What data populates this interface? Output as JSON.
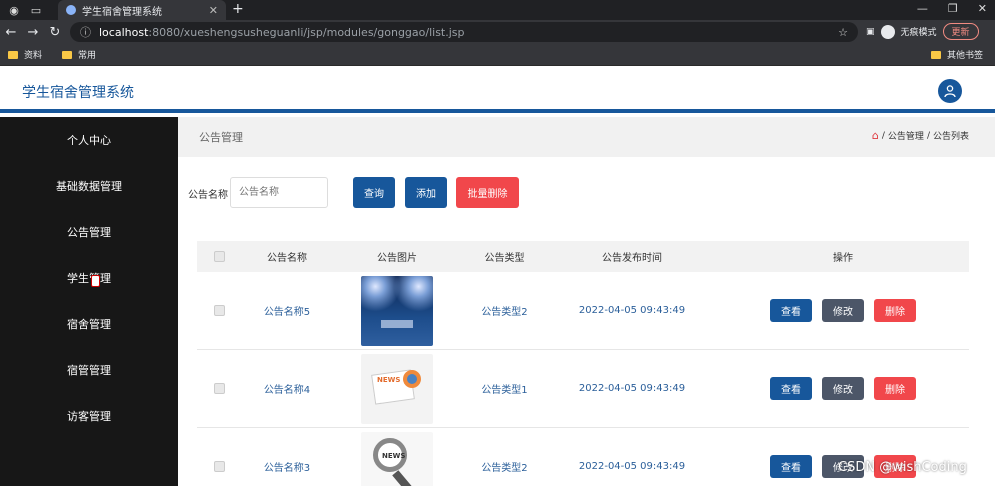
{
  "browser": {
    "tab_title": "学生宿舍管理系统",
    "url_host": "localhost",
    "url_rest": ":8080/xueshengsusheguanli/jsp/modules/gonggao/list.jsp",
    "incognito_label": "无痕模式",
    "update_label": "更新",
    "bookmarks": [
      "资料",
      "常用"
    ],
    "other_bookmarks": "其他书签"
  },
  "header": {
    "title": "学生宿舍管理系统"
  },
  "sidebar": {
    "items": [
      {
        "label": "个人中心"
      },
      {
        "label": "基础数据管理"
      },
      {
        "label": "公告管理"
      },
      {
        "label": "学生管理"
      },
      {
        "label": "宿舍管理"
      },
      {
        "label": "宿管管理"
      },
      {
        "label": "访客管理"
      }
    ]
  },
  "page": {
    "title": "公告管理",
    "breadcrumb": [
      "公告管理",
      "公告列表"
    ]
  },
  "search": {
    "label": "公告名称",
    "placeholder": "公告名称",
    "query_button": "查询",
    "add_button": "添加",
    "batch_delete_button": "批量删除"
  },
  "table": {
    "headers": [
      "公告名称",
      "公告图片",
      "公告类型",
      "公告发布时间",
      "操作"
    ],
    "rows": [
      {
        "name": "公告名称5",
        "type": "公告类型2",
        "time": "2022-04-05 09:43:49",
        "image": "stage-photo"
      },
      {
        "name": "公告名称4",
        "type": "公告类型1",
        "time": "2022-04-05 09:43:49",
        "image": "news-illustration"
      },
      {
        "name": "公告名称3",
        "type": "公告类型2",
        "time": "2022-04-05 09:43:49",
        "image": "magnifier-news"
      }
    ],
    "actions": {
      "view": "查看",
      "edit": "修改",
      "delete": "删除"
    }
  },
  "watermark": "CSDN @wishCoding",
  "colors": {
    "primary": "#17579b",
    "danger": "#f1474b",
    "edit": "#4c5668",
    "sidebar_bg": "#171717"
  }
}
